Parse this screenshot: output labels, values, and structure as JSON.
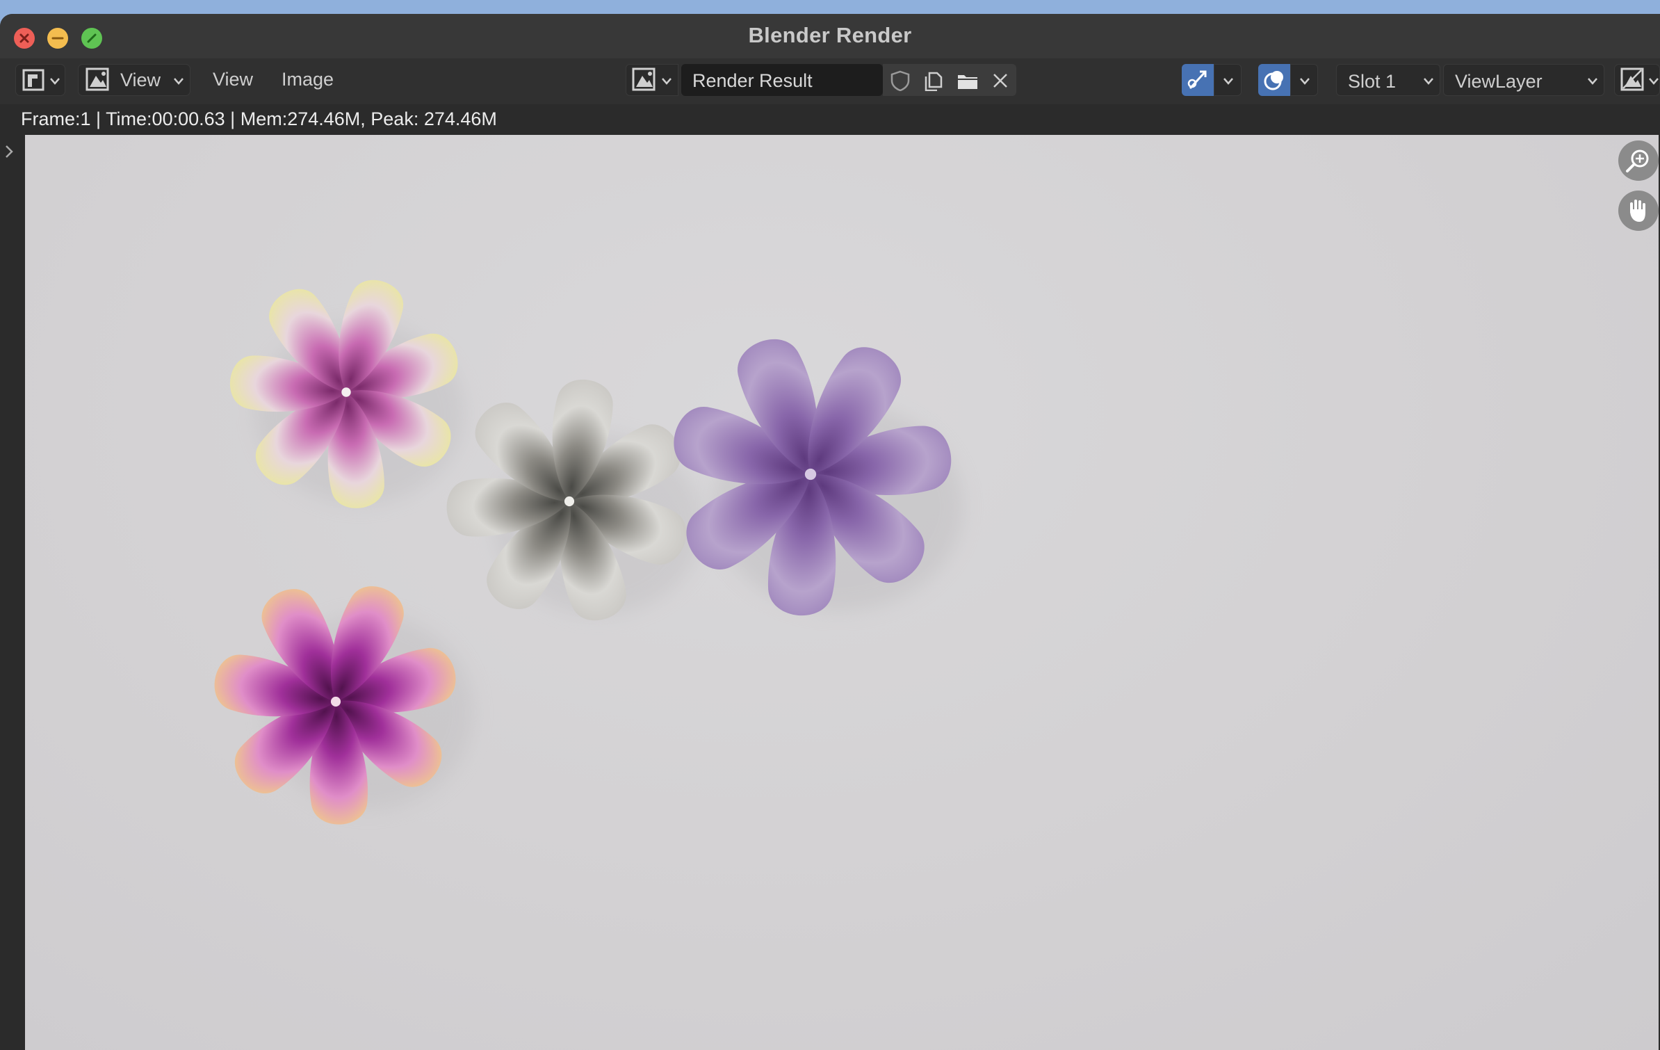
{
  "window": {
    "title": "Blender Render"
  },
  "header": {
    "editor_type_icon": "image-editor-icon",
    "view_mode_icon": "image-view-icon",
    "view_mode_label": "View",
    "menu_view": "View",
    "menu_image": "Image",
    "browse_image_icon": "image-browse-icon",
    "image_name": "Render Result",
    "fake_user_icon": "shield-icon",
    "new_image_icon": "duplicate-icon",
    "open_image_icon": "folder-icon",
    "unlink_icon": "close-icon",
    "gizmo_icon": "gizmo-icon",
    "overlay_icon": "overlay-icon",
    "slot_label": "Slot 1",
    "view_layer_label": "ViewLayer",
    "display_channels_icon": "display-channels-icon"
  },
  "info": {
    "frame": "Frame:1",
    "time": "Time:00:00.63",
    "mem": "Mem:274.46M, Peak: 274.46M"
  },
  "navigation": {
    "zoom_icon": "zoom-icon",
    "pan_icon": "hand-icon"
  },
  "colors": {
    "accent_blue": "#4772b3",
    "viewport_bg": "#d3d1d3",
    "close": "#ee5f57",
    "minimize": "#f4bd4f",
    "maximize": "#5fc453"
  }
}
